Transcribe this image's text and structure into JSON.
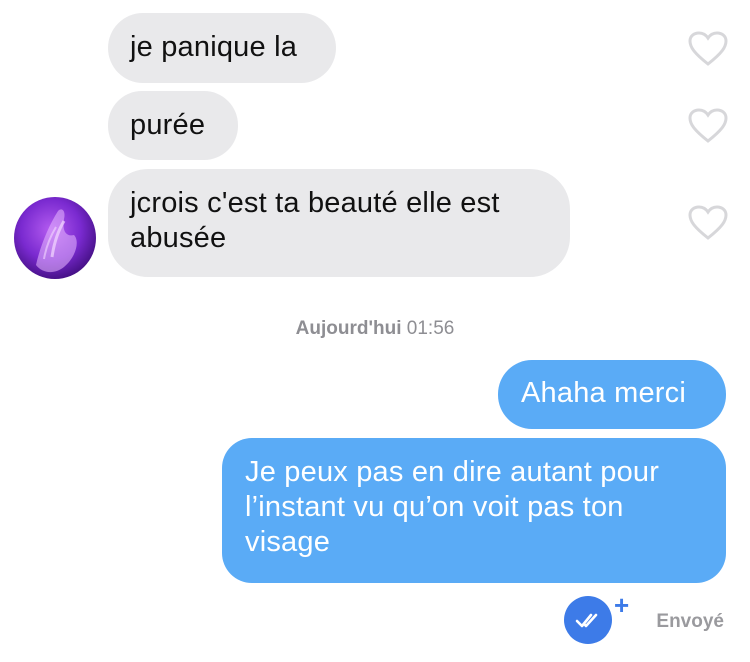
{
  "messages": [
    {
      "direction": "in",
      "text": "je panique la",
      "liked": false
    },
    {
      "direction": "in",
      "text": "purée",
      "liked": false
    },
    {
      "direction": "in",
      "text": "jcrois c'est ta beauté elle est abusée",
      "liked": false
    },
    {
      "direction": "out",
      "text": "Ahaha merci"
    },
    {
      "direction": "out",
      "text": "Je peux pas en dire autant pour l’instant vu qu’on voit pas ton visage"
    }
  ],
  "timestamp": {
    "day": "Aujourd'hui",
    "time": "01:56"
  },
  "status": {
    "label": "Envoyé",
    "plus": "+"
  },
  "icons": {
    "like": "heart-outline-icon",
    "read": "double-check-icon",
    "avatar": "contact-avatar"
  },
  "colors": {
    "outgoing_bubble": "#5aabf6",
    "incoming_bubble": "#e9e9eb",
    "read_badge": "#3d7be8"
  }
}
